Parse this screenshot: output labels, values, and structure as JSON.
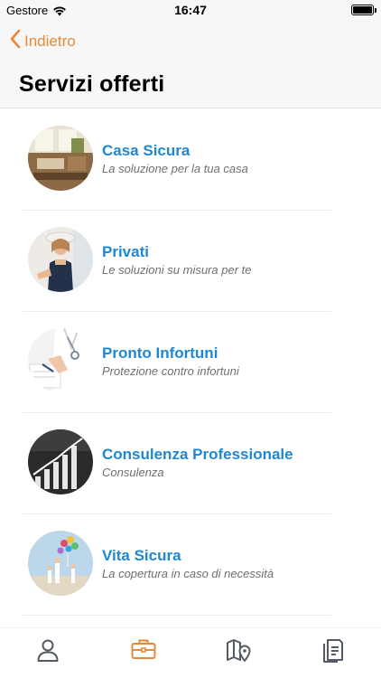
{
  "status_bar": {
    "carrier": "Gestore",
    "time": "16:47"
  },
  "nav": {
    "back_label": "Indietro",
    "title": "Servizi offerti"
  },
  "services": [
    {
      "title": "Casa Sicura",
      "subtitle": "La soluzione per la tua casa",
      "image": "living-room-photo"
    },
    {
      "title": "Privati",
      "subtitle": "Le soluzioni su misura per te",
      "image": "woman-with-hat-photo"
    },
    {
      "title": "Pronto Infortuni",
      "subtitle": "Protezione contro infortuni",
      "image": "doctor-writing-photo"
    },
    {
      "title": "Consulenza Professionale",
      "subtitle": "Consulenza",
      "image": "growth-chart-photo"
    },
    {
      "title": "Vita Sicura",
      "subtitle": "La copertura in caso di necessità",
      "image": "family-balloons-photo"
    }
  ],
  "tab_bar": {
    "tabs": [
      {
        "icon": "person-icon",
        "selected": false
      },
      {
        "icon": "briefcase-icon",
        "selected": true
      },
      {
        "icon": "map-pin-icon",
        "selected": false
      },
      {
        "icon": "document-icon",
        "selected": false
      }
    ]
  },
  "colors": {
    "accent": "#e8883a",
    "link_blue": "#1e88d3",
    "subtitle_gray": "#6f6f6f",
    "tab_gray": "#555b66"
  }
}
